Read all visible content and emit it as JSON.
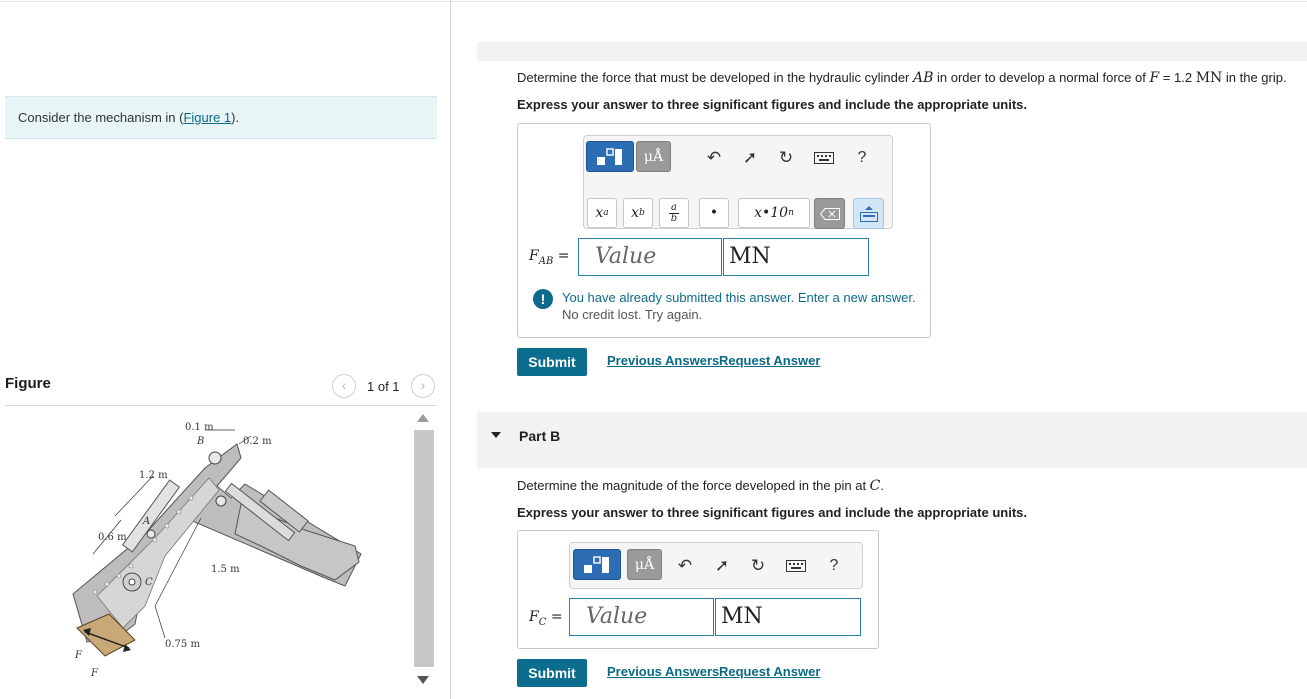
{
  "intro": {
    "prefix": "Consider the mechanism in (",
    "link": "Figure 1",
    "suffix": ")."
  },
  "figure": {
    "title": "Figure",
    "pager": "1 of 1",
    "prev_icon": "chevron-left-icon",
    "next_icon": "chevron-right-icon",
    "labels": {
      "d01": "0.1 m",
      "d02": "0.2 m",
      "d12": "1.2 m",
      "d06": "0.6 m",
      "d15": "1.5 m",
      "d075": "0.75 m",
      "B": "B",
      "A": "A",
      "C": "C",
      "F1": "F",
      "F2": "F"
    }
  },
  "partA": {
    "question": {
      "t1": "Determine the force that must be developed in the hydraulic cylinder ",
      "sym1": "AB",
      "t2": " in order to develop a normal force of ",
      "sym2": "F",
      "t3": " = 1.2 ",
      "unit": "MN",
      "t4": " in the grip."
    },
    "instruction": "Express your answer to three significant figures and include the appropriate units.",
    "toolbar": {
      "unit_btn": "μÅ",
      "help": "?",
      "xa": "xª",
      "xb": "x_b",
      "frac_top": "a",
      "frac_bot": "b",
      "dot": "•",
      "sci": "x•10ⁿ"
    },
    "label_main": "F",
    "label_sub": "AB",
    "label_eq": " =",
    "value_placeholder": "Value",
    "unit_value": "MN",
    "warning": "You have already submitted this answer. Enter a new answer.",
    "warning_sub": "No credit lost. Try again.",
    "submit": "Submit",
    "previous_answers": "Previous Answers",
    "request_answer": "Request Answer"
  },
  "partB": {
    "title": "Part B",
    "question": {
      "t1": "Determine the magnitude of the force developed in the pin at ",
      "sym": "C",
      "t2": "."
    },
    "instruction": "Express your answer to three significant figures and include the appropriate units.",
    "toolbar": {
      "unit_btn": "μÅ",
      "help": "?"
    },
    "label_main": "F",
    "label_sub": "C",
    "label_eq": " =",
    "value_placeholder": "Value",
    "unit_value": "MN",
    "submit": "Submit",
    "previous_answers": "Previous Answers",
    "request_answer": "Request Answer"
  },
  "colors": {
    "accent": "#0c6e8e",
    "link": "#0a6a87",
    "toolbar_blue": "#2d6db4",
    "intro_bg": "#e8f5f6"
  }
}
